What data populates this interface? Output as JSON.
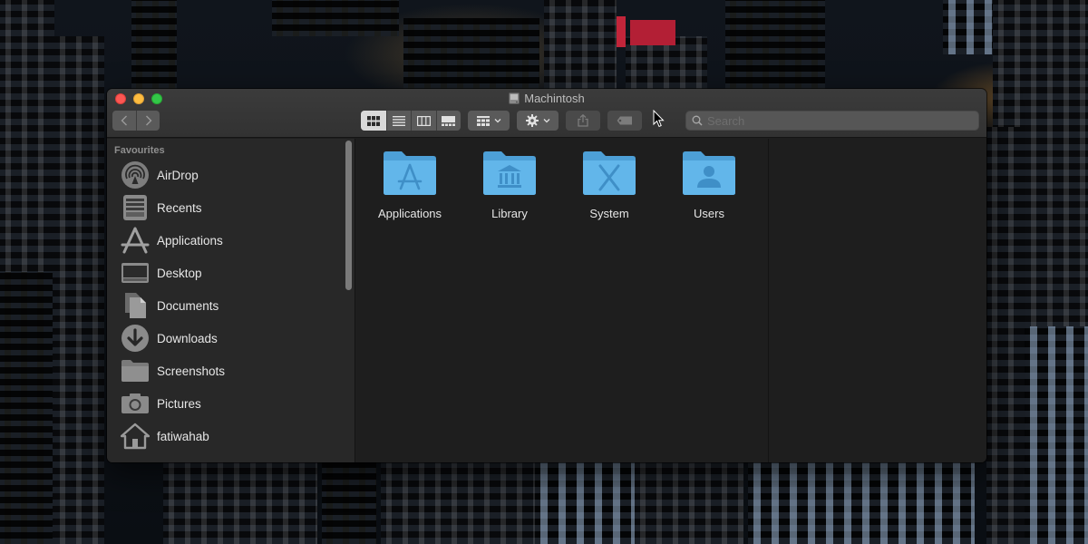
{
  "window": {
    "title": "Machintosh"
  },
  "toolbar": {
    "search_placeholder": "Search"
  },
  "sidebar": {
    "heading": "Favourites",
    "items": [
      {
        "label": "AirDrop",
        "icon": "airdrop-icon"
      },
      {
        "label": "Recents",
        "icon": "recents-icon"
      },
      {
        "label": "Applications",
        "icon": "applications-icon"
      },
      {
        "label": "Desktop",
        "icon": "desktop-icon"
      },
      {
        "label": "Documents",
        "icon": "documents-icon"
      },
      {
        "label": "Downloads",
        "icon": "downloads-icon"
      },
      {
        "label": "Screenshots",
        "icon": "folder-icon"
      },
      {
        "label": "Pictures",
        "icon": "camera-icon"
      },
      {
        "label": "fatiwahab",
        "icon": "home-icon"
      }
    ]
  },
  "files": [
    {
      "name": "Applications",
      "glyph": "applications-glyph"
    },
    {
      "name": "Library",
      "glyph": "library-glyph"
    },
    {
      "name": "System",
      "glyph": "system-glyph"
    },
    {
      "name": "Users",
      "glyph": "users-glyph"
    }
  ],
  "colors": {
    "folder_blue": "#5fb0e3",
    "window_bg": "#1e1e1e",
    "sidebar_bg": "#282828"
  }
}
